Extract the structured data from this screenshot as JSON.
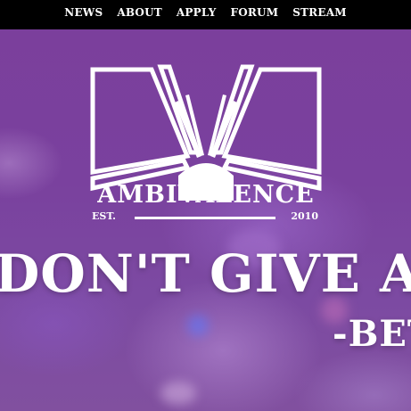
{
  "nav": {
    "items": [
      "NEWS",
      "ABOUT",
      "APPLY",
      "FORUM",
      "STREAM"
    ]
  },
  "logo": {
    "name": "AMBIVALENCE",
    "est_label": "EST.",
    "year": "2010"
  },
  "hero": {
    "quote": "DON'T GIVE A F",
    "attribution": "-BET"
  },
  "colors": {
    "nav_bg": "#000000",
    "hero_purple": "#7b3f9c",
    "text": "#ffffff"
  }
}
